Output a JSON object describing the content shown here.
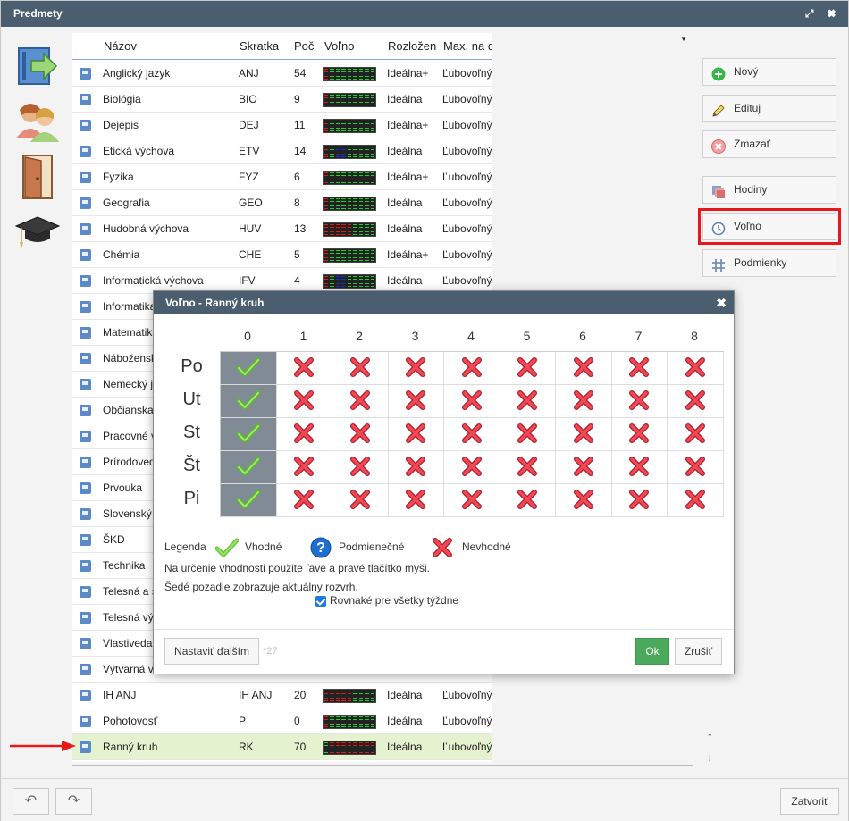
{
  "window": {
    "title": "Predmety",
    "maximize_glyph": "⤢",
    "close_glyph": "✖"
  },
  "side_icons": [
    {
      "name": "subjects-arrow-icon"
    },
    {
      "name": "teachers-icon"
    },
    {
      "name": "classrooms-door-icon"
    },
    {
      "name": "graduation-cap-icon"
    }
  ],
  "grid": {
    "headers": {
      "name": "Názov",
      "short": "Skratka",
      "count": "Poč",
      "free": "Voľno",
      "dist": "Rozložen",
      "max": "Max. na d"
    },
    "rows": [
      {
        "name": "Anglický jazyk",
        "short": "ANJ",
        "count": "54",
        "dist": "Ideálna+",
        "max": "Ľubovoľný",
        "bar": "g"
      },
      {
        "name": "Biológia",
        "short": "BIO",
        "count": "9",
        "dist": "Ideálna",
        "max": "Ľubovoľný",
        "bar": "g"
      },
      {
        "name": "Dejepis",
        "short": "DEJ",
        "count": "11",
        "dist": "Ideálna+",
        "max": "Ľubovoľný",
        "bar": "g"
      },
      {
        "name": "Etická výchova",
        "short": "ETV",
        "count": "14",
        "dist": "Ideálna",
        "max": "Ľubovoľný",
        "bar": "b"
      },
      {
        "name": "Fyzika",
        "short": "FYZ",
        "count": "6",
        "dist": "Ideálna+",
        "max": "Ľubovoľný",
        "bar": "g"
      },
      {
        "name": "Geografia",
        "short": "GEO",
        "count": "8",
        "dist": "Ideálna",
        "max": "Ľubovoľný",
        "bar": "g"
      },
      {
        "name": "Hudobná výchova",
        "short": "HUV",
        "count": "13",
        "dist": "Ideálna",
        "max": "Ľubovoľný",
        "bar": "h"
      },
      {
        "name": "Chémia",
        "short": "CHE",
        "count": "5",
        "dist": "Ideálna+",
        "max": "Ľubovoľný",
        "bar": "g"
      },
      {
        "name": "Informatická výchova",
        "short": "IFV",
        "count": "4",
        "dist": "Ideálna",
        "max": "Ľubovoľný",
        "bar": "b"
      },
      {
        "name": "Informatika",
        "short": "",
        "count": "",
        "dist": "",
        "max": "",
        "bar": ""
      },
      {
        "name": "Matematika",
        "short": "",
        "count": "",
        "dist": "",
        "max": "",
        "bar": ""
      },
      {
        "name": "Náboženská",
        "short": "",
        "count": "",
        "dist": "",
        "max": "",
        "bar": ""
      },
      {
        "name": "Nemecký jazyk",
        "short": "",
        "count": "",
        "dist": "",
        "max": "",
        "bar": ""
      },
      {
        "name": "Občianska",
        "short": "",
        "count": "",
        "dist": "",
        "max": "",
        "bar": ""
      },
      {
        "name": "Pracovné v",
        "short": "",
        "count": "",
        "dist": "",
        "max": "",
        "bar": ""
      },
      {
        "name": "Prírodoveda",
        "short": "",
        "count": "",
        "dist": "",
        "max": "",
        "bar": ""
      },
      {
        "name": "Prvouka",
        "short": "",
        "count": "",
        "dist": "",
        "max": "",
        "bar": ""
      },
      {
        "name": "Slovenský jazyk",
        "short": "",
        "count": "",
        "dist": "",
        "max": "",
        "bar": ""
      },
      {
        "name": "ŠKD",
        "short": "",
        "count": "",
        "dist": "",
        "max": "",
        "bar": ""
      },
      {
        "name": "Technika",
        "short": "",
        "count": "",
        "dist": "",
        "max": "",
        "bar": ""
      },
      {
        "name": "Telesná a š",
        "short": "",
        "count": "",
        "dist": "",
        "max": "",
        "bar": ""
      },
      {
        "name": "Telesná vý",
        "short": "",
        "count": "",
        "dist": "",
        "max": "",
        "bar": ""
      },
      {
        "name": "Vlastiveda",
        "short": "",
        "count": "",
        "dist": "",
        "max": "",
        "bar": ""
      },
      {
        "name": "Výtvarná v",
        "short": "",
        "count": "",
        "dist": "",
        "max": "",
        "bar": ""
      },
      {
        "name": "IH ANJ",
        "short": "IH ANJ",
        "count": "20",
        "dist": "Ideálna",
        "max": "Ľubovoľný",
        "bar": "h"
      },
      {
        "name": "Pohotovosť",
        "short": "P",
        "count": "0",
        "dist": "Ideálna",
        "max": "Ľubovoľný",
        "bar": "g"
      },
      {
        "name": "Ranný kruh",
        "short": "RK",
        "count": "70",
        "dist": "Ideálna",
        "max": "Ľubovoľný",
        "bar": "r"
      }
    ],
    "selected_index": 26
  },
  "actions": {
    "new": "Nový",
    "edit": "Edituj",
    "delete": "Zmazať",
    "hours": "Hodiny",
    "free": "Voľno",
    "conditions": "Podmienky"
  },
  "footer": {
    "undo_glyph": "↶",
    "redo_glyph": "↷",
    "close": "Zatvoriť"
  },
  "sort": {
    "up": "↑",
    "down": "↓"
  },
  "colors": {
    "titlebar": "#4a5e6f",
    "selected_row": "#e5f2cf",
    "highlight": "#e3191b",
    "ok_button": "#4aa95b",
    "current_cell": "#818b96"
  },
  "dialog": {
    "title": "Voľno - Ranný kruh",
    "close_glyph": "✖",
    "columns": [
      "0",
      "1",
      "2",
      "3",
      "4",
      "5",
      "6",
      "7",
      "8"
    ],
    "days": [
      "Po",
      "Ut",
      "St",
      "Št",
      "Pi"
    ],
    "cells": [
      [
        "ok",
        "no",
        "no",
        "no",
        "no",
        "no",
        "no",
        "no",
        "no"
      ],
      [
        "ok",
        "no",
        "no",
        "no",
        "no",
        "no",
        "no",
        "no",
        "no"
      ],
      [
        "ok",
        "no",
        "no",
        "no",
        "no",
        "no",
        "no",
        "no",
        "no"
      ],
      [
        "ok",
        "no",
        "no",
        "no",
        "no",
        "no",
        "no",
        "no",
        "no"
      ],
      [
        "ok",
        "no",
        "no",
        "no",
        "no",
        "no",
        "no",
        "no",
        "no"
      ]
    ],
    "legend": {
      "title": "Legenda",
      "ok": "Vhodné",
      "cond": "Podmienečné",
      "no": "Nevhodné"
    },
    "note1": "Na určenie vhodnosti použite ľavé a pravé tlačítko myši.",
    "note2": "Šedé pozadie zobrazuje aktuálny rozvrh.",
    "same_weeks": {
      "label": "Rovnaké pre všetky týždne",
      "checked": true
    },
    "set_others": "Nastaviť ďalším",
    "set_others_count": "*27",
    "ok": "Ok",
    "cancel": "Zrušiť"
  }
}
